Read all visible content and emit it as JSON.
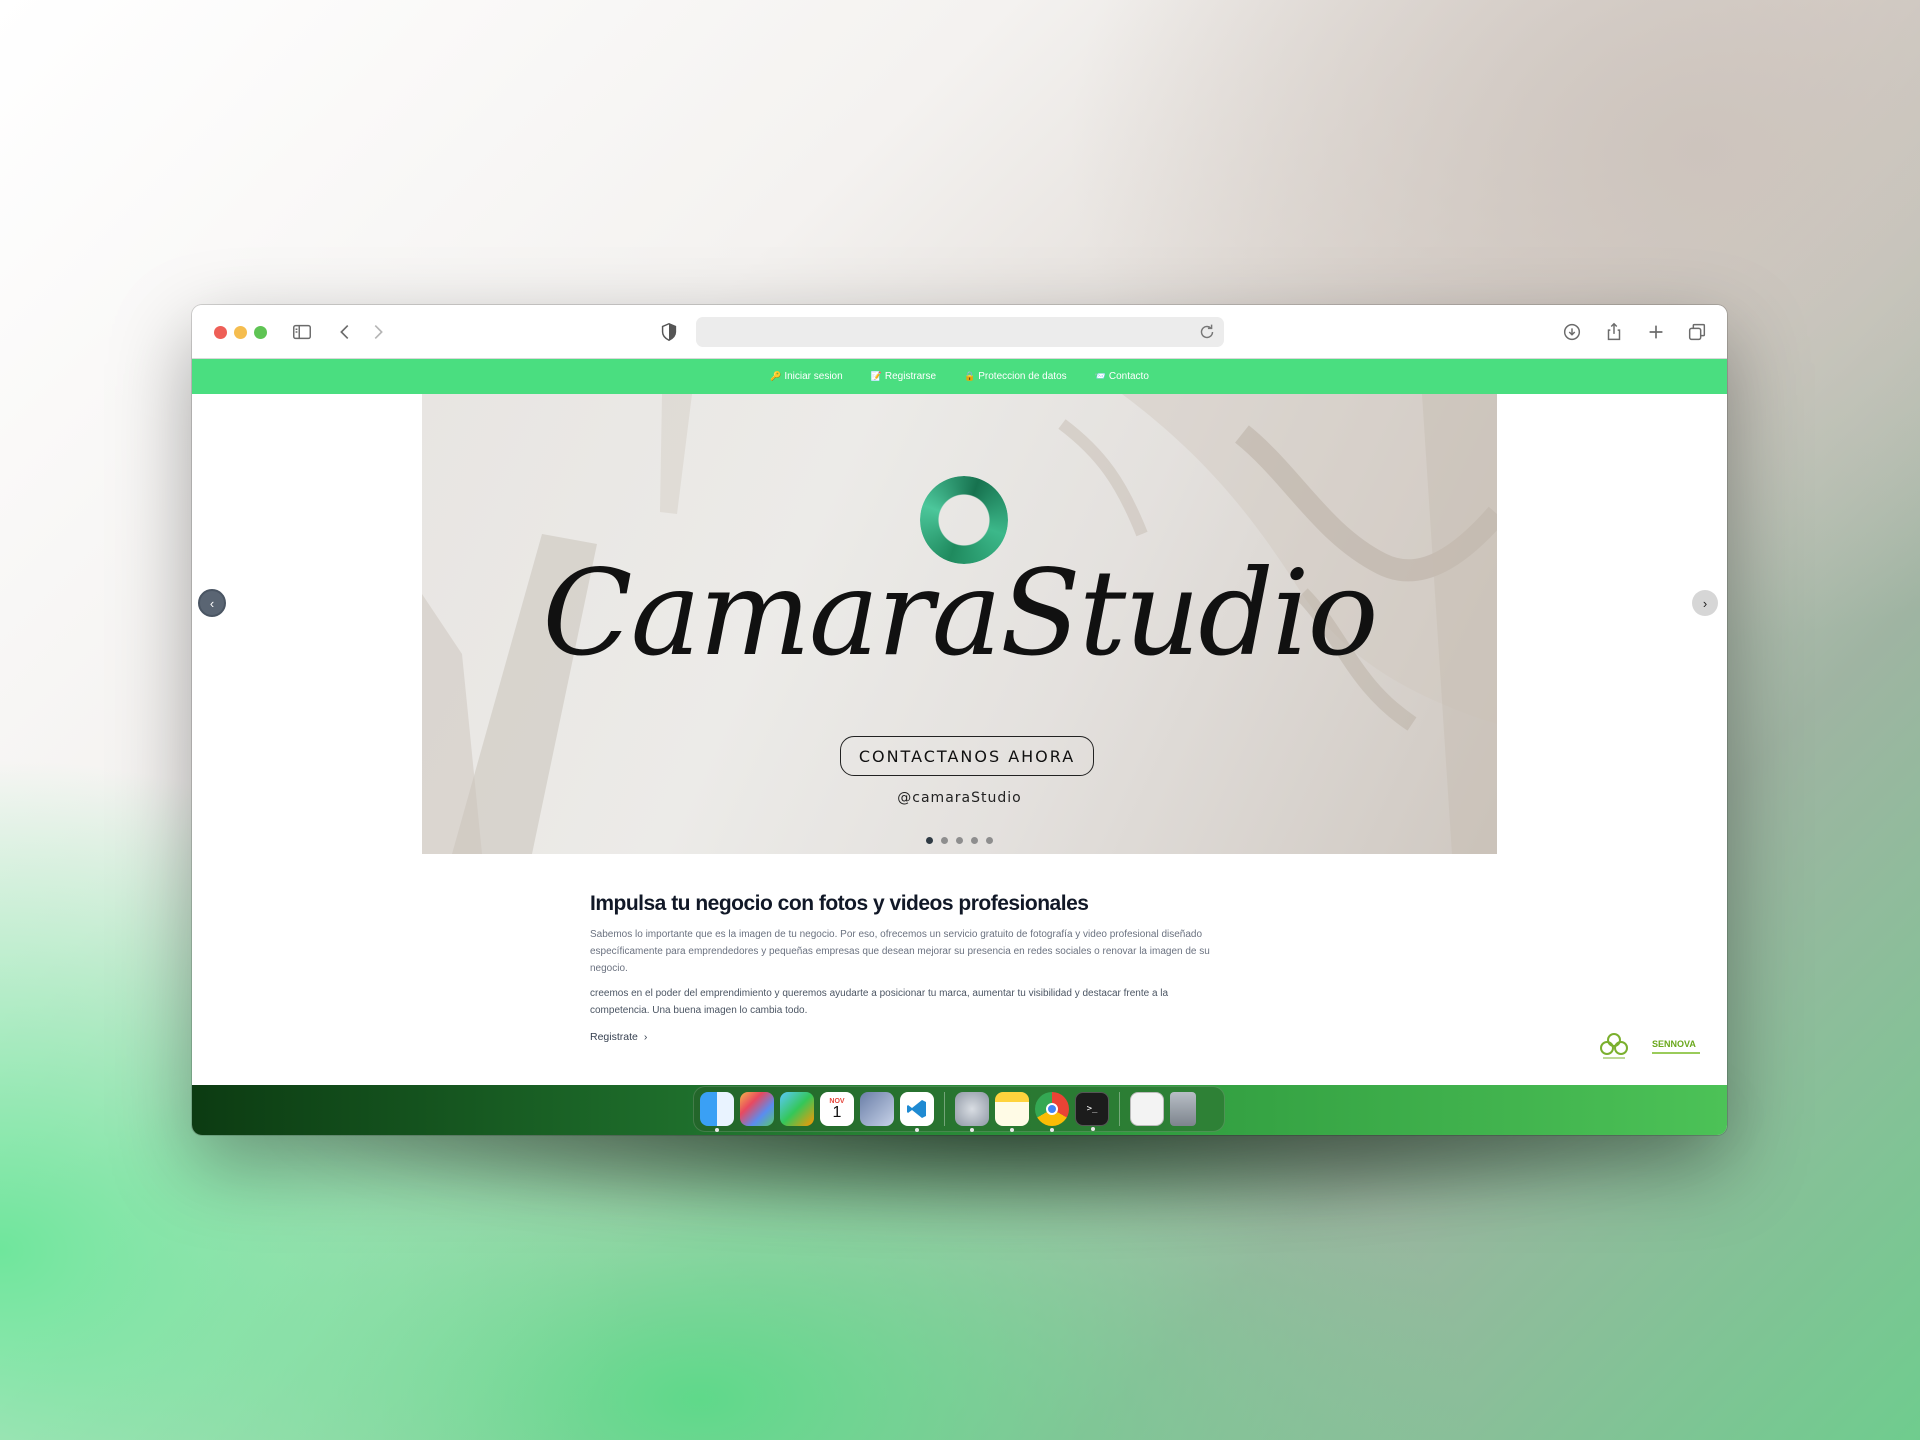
{
  "browser": {
    "url": "",
    "icons": [
      "sidebar-icon",
      "back-icon",
      "forward-icon",
      "shield-icon",
      "reload-icon",
      "download-icon",
      "share-icon",
      "new-tab-icon",
      "tabs-overview-icon"
    ]
  },
  "nav": {
    "items": [
      {
        "emoji": "🔑",
        "label": "Iniciar sesion"
      },
      {
        "emoji": "📝",
        "label": "Registrarse"
      },
      {
        "emoji": "🔒",
        "label": "Proteccion de datos"
      },
      {
        "emoji": "📨",
        "label": "Contacto"
      }
    ]
  },
  "hero": {
    "brand": "CamaraStudio",
    "cta": "CONTACTANOS AHORA",
    "handle": "@camaraStudio",
    "slides": 5,
    "active_slide": 1,
    "prev_icon": "‹",
    "next_icon": "›"
  },
  "section": {
    "title": "Impulsa tu negocio con fotos y videos profesionales",
    "paragraph1": "Sabemos lo importante que es la imagen de tu negocio. Por eso, ofrecemos un servicio gratuito de fotografía y video profesional diseñado específicamente para emprendedores y pequeñas empresas que desean mejorar su presencia en redes sociales o renovar la imagen de su negocio.",
    "paragraph2": "creemos en el poder del emprendimiento y queremos ayudarte a posicionar tu marca, aumentar tu visibilidad y destacar frente a la competencia. Una buena imagen lo cambia todo.",
    "link": "Registrate",
    "link_icon": "›"
  },
  "footer_logos": {
    "sennova": "SENNOVA"
  },
  "dock": {
    "calendar_month": "NOV",
    "calendar_day": "1",
    "terminal_prompt": ">_",
    "apps": [
      "finder-icon",
      "launchpad-icon",
      "appstore-icon",
      "calendar-icon",
      "virtualbox-icon",
      "vscode-icon",
      "settings-icon",
      "notes-icon",
      "chrome-icon",
      "terminal-icon",
      "preview-icon",
      "trash-icon"
    ]
  },
  "colors": {
    "navbar": "#4ade80",
    "ring": "#2f9f74",
    "heading": "#111827"
  }
}
